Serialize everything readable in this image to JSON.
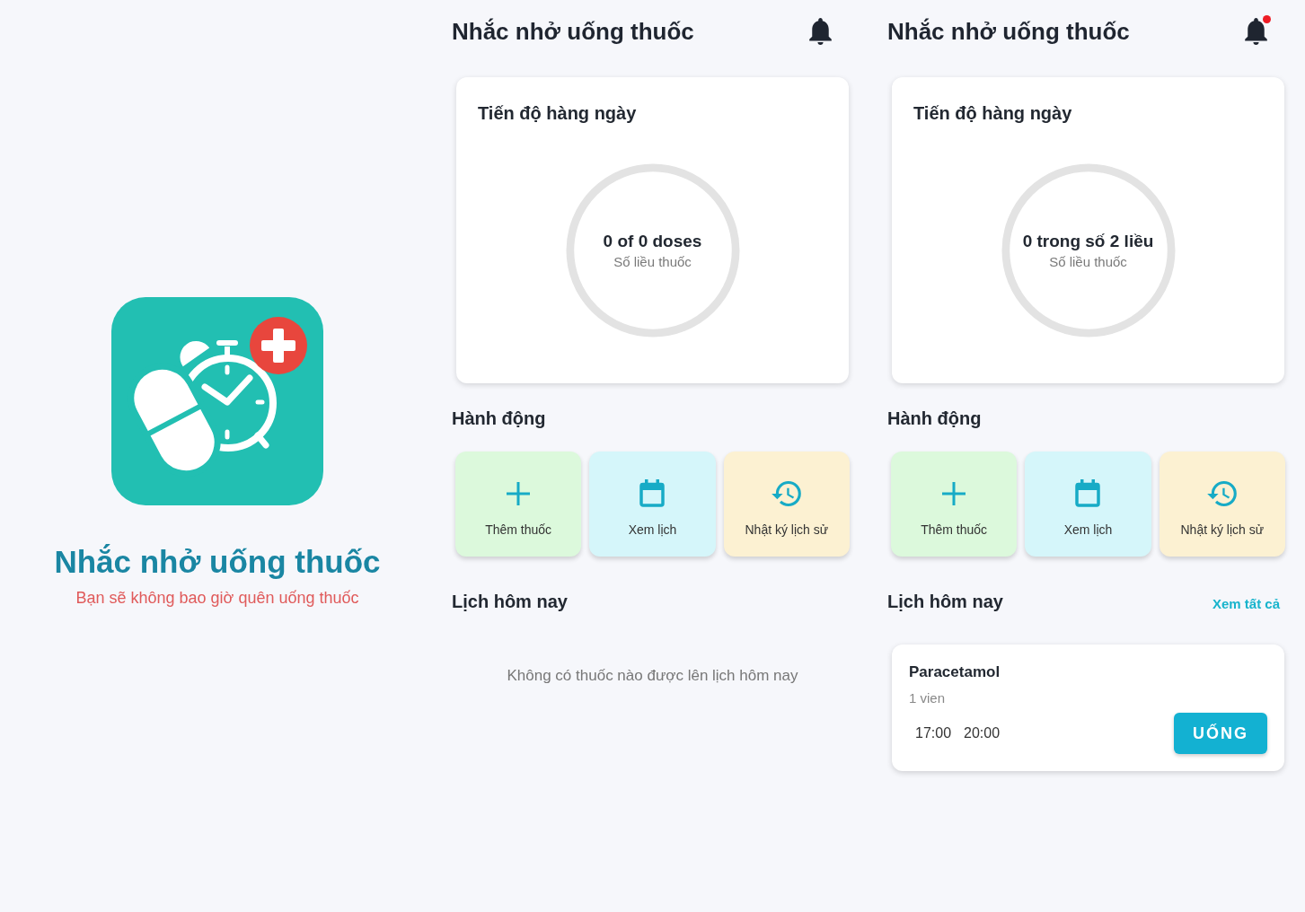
{
  "splash": {
    "title": "Nhắc nhở uống thuốc",
    "subtitle": "Bạn sẽ không bao giờ quên uống thuốc"
  },
  "screens": [
    {
      "header": {
        "title": "Nhắc nhở uống thuốc",
        "has_notification": false
      },
      "progress": {
        "title": "Tiến độ hàng ngày",
        "count": "0 of 0 doses",
        "caption": "Số liều thuốc"
      },
      "actions": {
        "title": "Hành động",
        "items": [
          {
            "kind": "add",
            "label": "Thêm thuốc",
            "color": "#dcf9dc"
          },
          {
            "kind": "calendar",
            "label": "Xem lịch",
            "color": "#d5f6fa"
          },
          {
            "kind": "history",
            "label": "Nhật ký lịch sử",
            "color": "#fcf1d2"
          }
        ]
      },
      "schedule": {
        "title": "Lịch hôm nay",
        "empty_message": "Không có thuốc nào được lên lịch hôm nay"
      }
    },
    {
      "header": {
        "title": "Nhắc nhở uống thuốc",
        "has_notification": true
      },
      "progress": {
        "title": "Tiến độ hàng ngày",
        "count": "0 trong số 2 liều",
        "caption": "Số liều thuốc"
      },
      "actions": {
        "title": "Hành động",
        "items": [
          {
            "kind": "add",
            "label": "Thêm thuốc",
            "color": "#dcf9dc"
          },
          {
            "kind": "calendar",
            "label": "Xem lịch",
            "color": "#d5f6fa"
          },
          {
            "kind": "history",
            "label": "Nhật ký lịch sử",
            "color": "#fcf1d2"
          }
        ]
      },
      "schedule": {
        "title": "Lịch hôm nay",
        "see_all": "Xem tất cả",
        "medications": [
          {
            "name": "Paracetamol",
            "dose": "1 vien",
            "times": [
              "17:00",
              "20:00"
            ],
            "action": "UỐNG"
          }
        ]
      }
    }
  ]
}
